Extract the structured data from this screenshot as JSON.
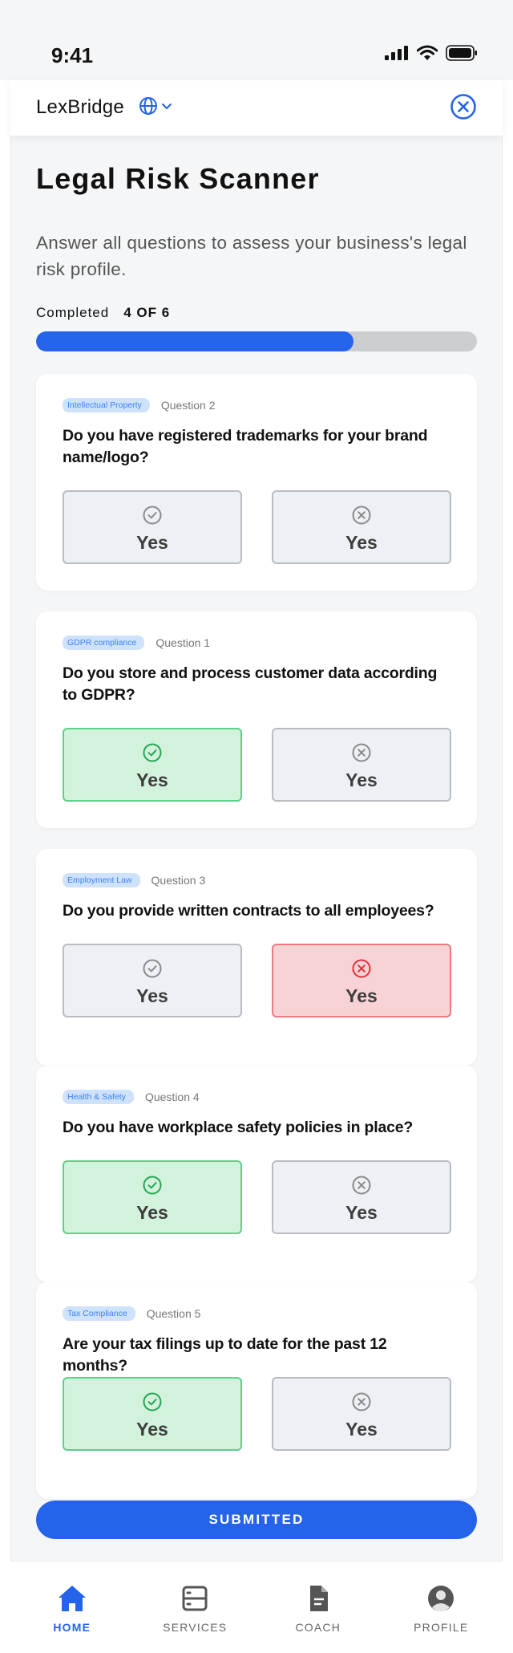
{
  "status_bar": {
    "time": "9:41"
  },
  "header": {
    "brand": "LexBridge"
  },
  "page": {
    "title": "Legal Risk Scanner",
    "subtitle": "Answer all questions to assess your business's legal risk profile."
  },
  "progress": {
    "label": "Completed",
    "count_text": "4 OF 6",
    "fraction": 0.72
  },
  "questions": [
    {
      "tag": "Intellectual Property",
      "number": "Question 2",
      "text": "Do you have registered trademarks for your brand name/logo?",
      "yes_label": "Yes",
      "no_label": "Yes",
      "selected": "none"
    },
    {
      "tag": "GDPR compliance",
      "number": "Question 1",
      "text": "Do you store and process customer data according to GDPR?",
      "yes_label": "Yes",
      "no_label": "Yes",
      "selected": "yes"
    },
    {
      "tag": "Employment Law",
      "number": "Question 3",
      "text": "Do you provide written contracts to all employees?",
      "yes_label": "Yes",
      "no_label": "Yes",
      "selected": "no"
    },
    {
      "tag": "Health & Safety",
      "number": "Question 4",
      "text": "Do you have workplace safety policies in place?",
      "yes_label": "Yes",
      "no_label": "Yes",
      "selected": "yes"
    },
    {
      "tag": "Tax Compliance",
      "number": "Question 5",
      "text": "Are your tax filings up to date for the past 12 months?",
      "yes_label": "Yes",
      "no_label": "Yes",
      "selected": "yes"
    }
  ],
  "submit": {
    "label": "SUBMITTED"
  },
  "tabs": [
    {
      "label": "HOME",
      "icon": "home-icon",
      "active": true
    },
    {
      "label": "SERVICES",
      "icon": "services-icon",
      "active": false
    },
    {
      "label": "COACH",
      "icon": "document-icon",
      "active": false
    },
    {
      "label": "PROFILE",
      "icon": "avatar-icon",
      "active": false
    }
  ],
  "colors": {
    "accent": "#2563eb",
    "yes_bg": "#d3f2dc",
    "yes_border": "#5cd188",
    "yes_icon": "#22a653",
    "no_bg": "#f8d3d5",
    "no_border": "#ec7a80",
    "no_icon": "#e0303a",
    "neutral_icon": "#8a8a8a"
  }
}
